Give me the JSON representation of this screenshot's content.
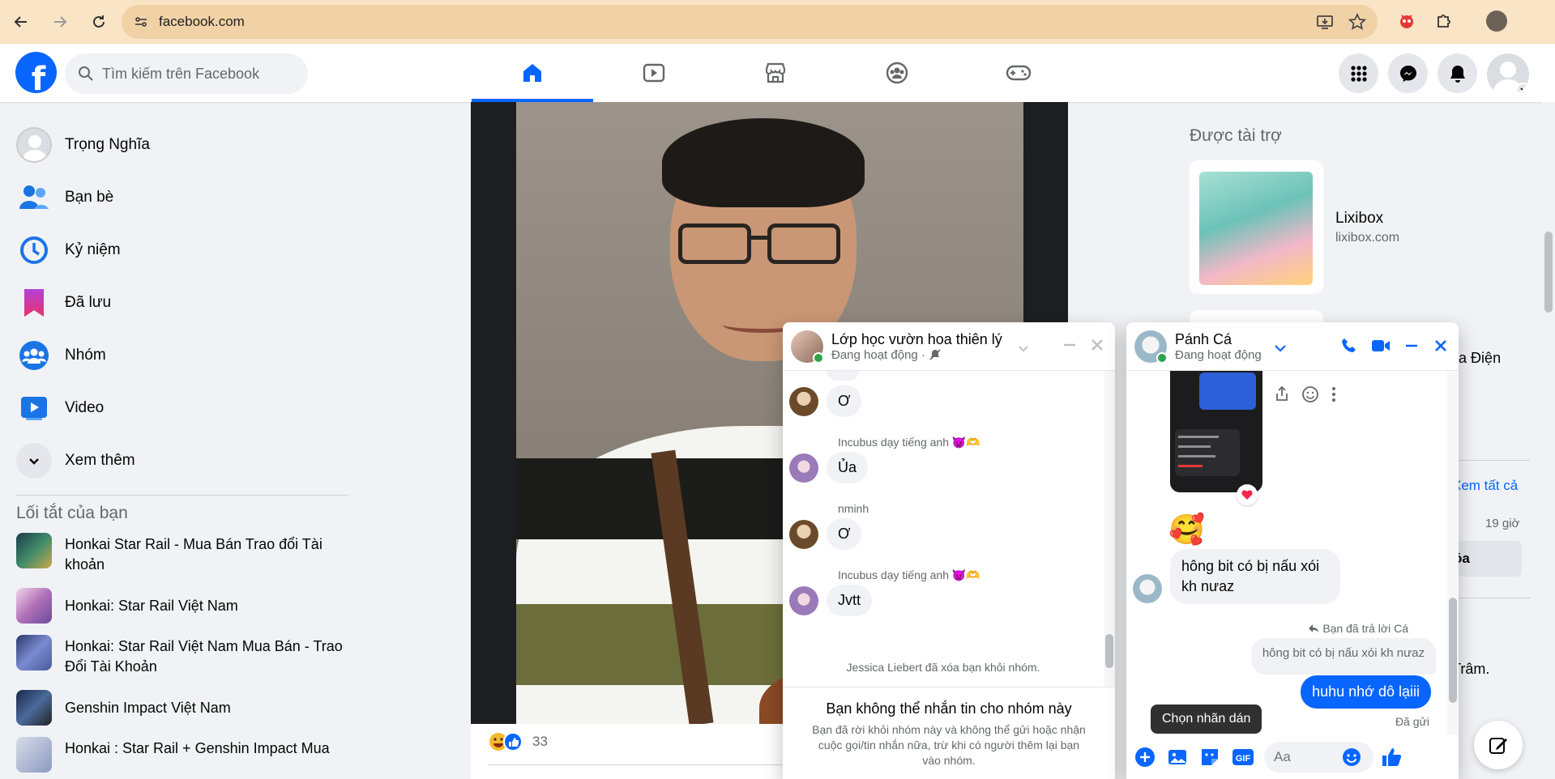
{
  "browser": {
    "url": "facebook.com",
    "icons": [
      "back-icon",
      "forward-icon",
      "reload-icon",
      "site-info-icon",
      "install-icon",
      "bookmark-star-icon",
      "extension-icon",
      "puzzle-icon",
      "profile-icon"
    ]
  },
  "header": {
    "logo_letter": "f",
    "search_placeholder": "Tìm kiếm trên Facebook",
    "tabs": [
      "home-icon",
      "video-icon",
      "marketplace-icon",
      "groups-icon",
      "gaming-icon"
    ],
    "active_tab": 0,
    "brand_color": "#0866ff"
  },
  "sidebar": {
    "items": [
      {
        "label": "Trọng Nghĩa",
        "icon": "profile-avatar"
      },
      {
        "label": "Bạn bè",
        "icon": "friends-icon"
      },
      {
        "label": "Kỷ niệm",
        "icon": "memories-icon"
      },
      {
        "label": "Đã lưu",
        "icon": "saved-icon"
      },
      {
        "label": "Nhóm",
        "icon": "groups-icon"
      },
      {
        "label": "Video",
        "icon": "video-icon"
      },
      {
        "label": "Xem thêm",
        "icon": "chevron-down-icon"
      }
    ],
    "shortcuts_title": "Lối tắt của bạn",
    "shortcuts": [
      "Honkai Star Rail - Mua Bán Trao đổi Tài khoản",
      "Honkai: Star Rail Việt Nam",
      "Honkai: Star Rail Việt Nam Mua Bán - Trao Đổi Tài Khoản",
      "Genshin Impact Việt Nam",
      "Honkai : Star Rail + Genshin Impact Mua"
    ]
  },
  "post": {
    "reaction_count": "33"
  },
  "right": {
    "sponsored_title": "Được tài trợ",
    "ad_name": "Lixibox",
    "ad_url": "lixibox.com",
    "partial_texts": {
      "contact_suffix": "ửa Điện",
      "see_all": "Xem tất cả",
      "time": "19 giờ",
      "delete": "óa",
      "name_suffix": "Trâm."
    }
  },
  "chat1": {
    "name": "Lớp học vườn hoa thiên lý",
    "status": "Đang hoạt động ·",
    "messages": [
      {
        "sender": "",
        "text": "Ơ"
      },
      {
        "sender": "Incubus dạy tiếng anh 👿🫶",
        "text": "Ủa"
      },
      {
        "sender": "nminh",
        "text": "Ơ"
      },
      {
        "sender": "Incubus dạy tiếng anh 👿🫶",
        "text": "Jvtt"
      }
    ],
    "system_msg": "Jessica Liebert đã xóa bạn khỏi nhóm.",
    "cannot_title": "Bạn không thể nhắn tin cho nhóm này",
    "cannot_desc": "Bạn đã rời khỏi nhóm này và không thể gửi hoặc nhận cuộc gọi/tin nhắn nữa, trừ khi có người thêm lại bạn vào nhóm."
  },
  "chat2": {
    "name": "Pánh Cá",
    "status": "Đang hoạt động",
    "emoji_msg": "🥰",
    "incoming": "hông bit có bị nấu xói kh nưaz",
    "reply_label": "Bạn đã trả lời Cá",
    "quoted": "hông bit có bị nấu xói kh nưaz",
    "outgoing": "huhu nhớ dô lạiii",
    "sent_status": "Đã gửi",
    "tooltip": "Chọn nhãn dán",
    "input_placeholder": "Aa",
    "accent": "#0866ff"
  }
}
